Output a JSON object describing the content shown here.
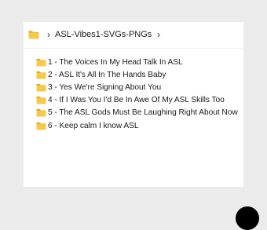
{
  "colors": {
    "page_background": "#ebebeb",
    "window_background": "#ffffff",
    "folder_yellow": "#f7c948",
    "folder_dark": "#e0a82e",
    "text": "#1a1a1a"
  },
  "address_bar": {
    "icon": "folder-icon",
    "chevron": "›",
    "path": "ASL-Vibes1-SVGs-PNGs",
    "trailing_chevron": "›"
  },
  "files": [
    {
      "name": "1 - The Voices In My Head Talk In ASL",
      "icon": "folder-icon"
    },
    {
      "name": "2 - ASL It's All In The Hands Baby",
      "icon": "folder-icon"
    },
    {
      "name": "3 - Yes We're Signing About You",
      "icon": "folder-icon"
    },
    {
      "name": "4 - If I Was You I'd Be In Awe Of My ASL Skills Too",
      "icon": "folder-icon"
    },
    {
      "name": "5 - The ASL Gods Must Be Laughing Right About Now",
      "icon": "folder-icon"
    },
    {
      "name": "6 - Keep calm I know ASL",
      "icon": "folder-icon"
    }
  ]
}
